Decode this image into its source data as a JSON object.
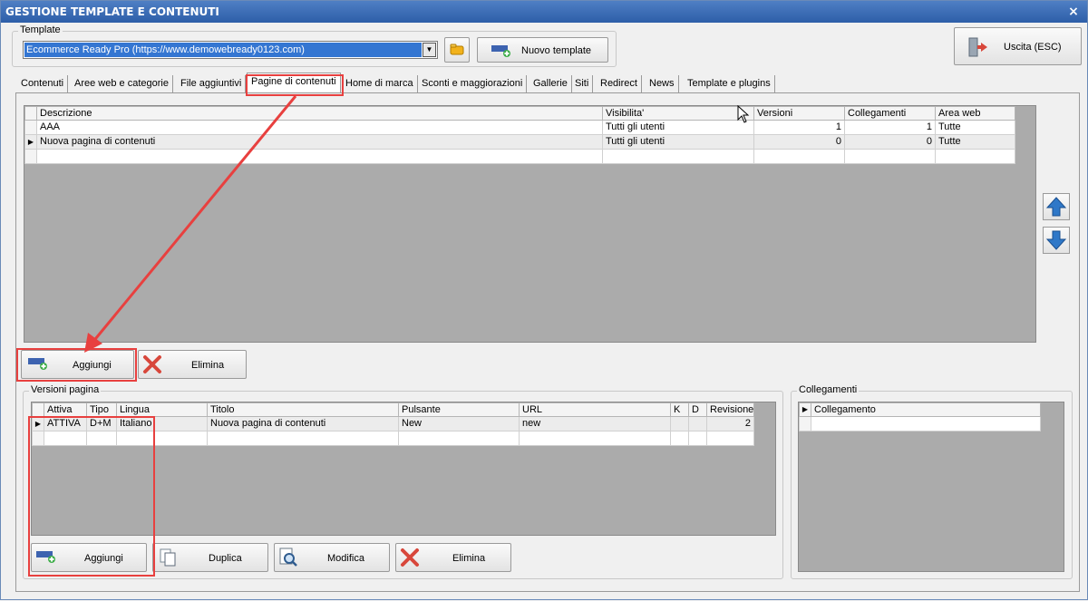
{
  "window": {
    "title": "GESTIONE TEMPLATE E CONTENUTI",
    "close": "×"
  },
  "template": {
    "group_label": "Template",
    "selected": "Ecommerce Ready Pro (https://www.demowebready0123.com)",
    "new_template": "Nuovo template",
    "exit": "Uscita (ESC)"
  },
  "tabs": [
    "Contenuti",
    "Aree web e categorie",
    "File aggiuntivi",
    "Pagine di contenuti",
    "Home di marca",
    "Sconti e maggiorazioni",
    "Gallerie",
    "Siti",
    "Redirect",
    "News",
    "Template e plugins"
  ],
  "pages_grid": {
    "columns": [
      "Descrizione",
      "Visibilita'",
      "Versioni",
      "Collegamenti",
      "Area web"
    ],
    "rows": [
      {
        "descrizione": "AAA",
        "visibilita": "Tutti gli utenti",
        "versioni": "1",
        "collegamenti": "1",
        "area": "Tutte"
      },
      {
        "descrizione": "Nuova pagina di contenuti",
        "visibilita": "Tutti gli utenti",
        "versioni": "0",
        "collegamenti": "0",
        "area": "Tutte"
      }
    ],
    "add": "Aggiungi",
    "delete": "Elimina"
  },
  "versions": {
    "group_label": "Versioni pagina",
    "columns": [
      "Attiva",
      "Tipo",
      "Lingua",
      "Titolo",
      "Pulsante",
      "URL",
      "K",
      "D",
      "Revisione"
    ],
    "rows": [
      {
        "attiva": "ATTIVA",
        "tipo": "D+M",
        "lingua": "Italiano",
        "titolo": "Nuova pagina di contenuti",
        "pulsante": "New",
        "url": "new",
        "k": "",
        "d": "",
        "revisione": "2"
      }
    ],
    "add": "Aggiungi",
    "duplicate": "Duplica",
    "modify": "Modifica",
    "delete": "Elimina"
  },
  "links": {
    "group_label": "Collegamenti",
    "columns": [
      "Collegamento"
    ]
  },
  "colors": {
    "titlebar": "#2d5ea8",
    "selection": "#3476d2",
    "annotation": "#e8403f",
    "arrow_blue": "#2f78c8"
  }
}
